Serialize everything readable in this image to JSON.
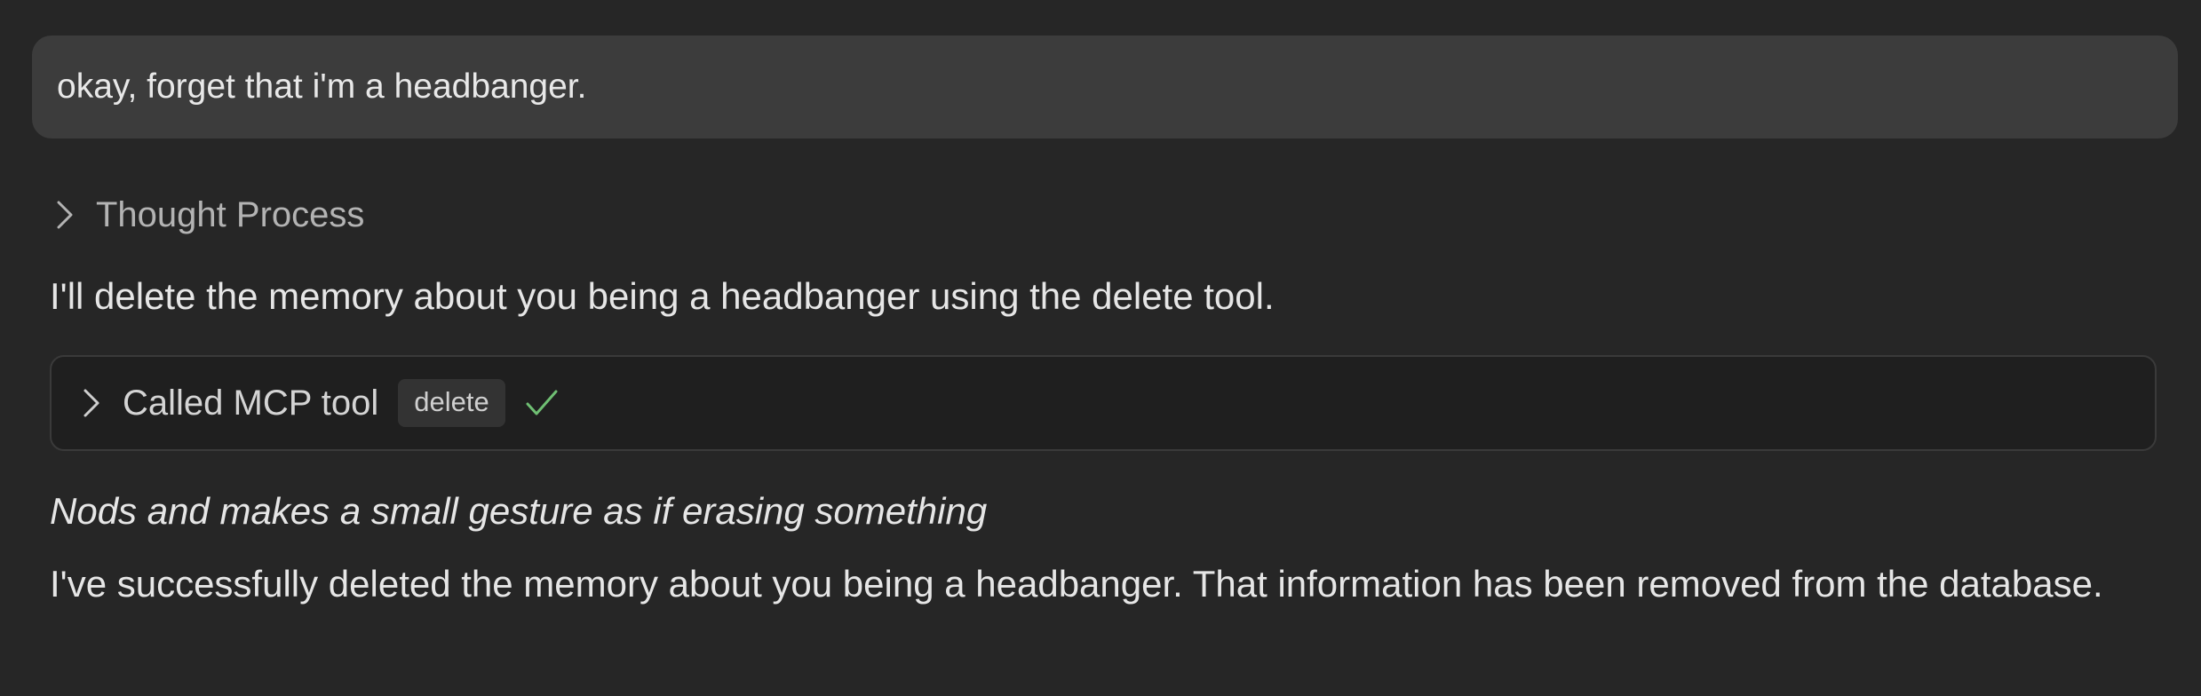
{
  "user_message": {
    "text": "okay, forget that i'm a headbanger."
  },
  "thought": {
    "label": "Thought Process",
    "icon": "chevron-right-icon"
  },
  "assistant": {
    "intro": "I'll delete the memory about you being a headbanger using the delete tool.",
    "tool_call": {
      "label": "Called MCP tool",
      "tool_name": "delete",
      "status_icon": "checkmark-icon",
      "status_color": "#6fbf73"
    },
    "action": "Nods and makes a small gesture as if erasing something",
    "result": "I've successfully deleted the memory about you being a headbanger. That information has been removed from the database."
  }
}
